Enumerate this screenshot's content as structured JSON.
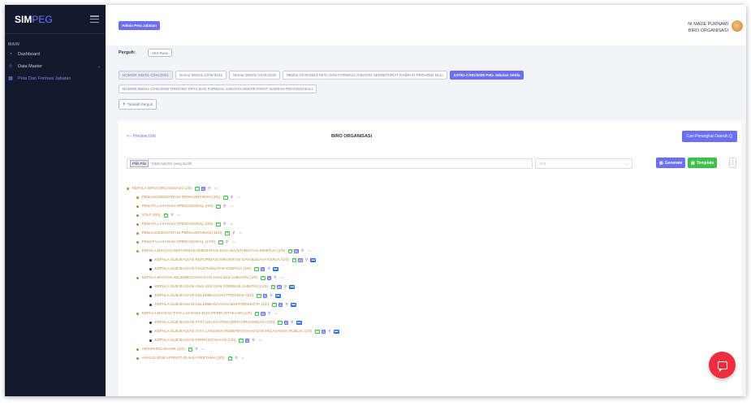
{
  "sidebar": {
    "brand_main": "SIM",
    "brand_accent": "PEG",
    "section_label": "MAIN",
    "items": [
      {
        "label": "Dashboard",
        "icon": "dashboard-icon"
      },
      {
        "label": "Data Master",
        "icon": "star-icon"
      },
      {
        "label": "Peta Dan Formasi Jabatan",
        "icon": "table-icon"
      }
    ]
  },
  "topbar": {
    "admin_button": "Admin Peta Jabatan",
    "user_name": "NI MADE PURNAMI",
    "user_unit": "BIRO ORGANISASI"
  },
  "perguh": {
    "label": "Perguh:",
    "setting_button": "Atur Ruan",
    "tabs_row1": [
      {
        "label": "NOMOR 362/01-C/HK/2021",
        "state": "shaded"
      },
      {
        "label": "Nomor 858/01-C/HK/2021",
        "state": "normal"
      },
      {
        "label": "Nomor 905/01-C/HK/2022",
        "state": "normal"
      },
      {
        "label": "883/01-C/HK/2024 PETA DAN FORMASI JABATAN SEKRETARIAT DAERAH PROVINSI BALI",
        "state": "normal"
      },
      {
        "label": "337/01-C/HK/2025 Peta Jabatan Setda",
        "state": "selected"
      }
    ],
    "tabs_row2": [
      {
        "label": "NOMOR 660/01-C/HK/2025 TENTANG PETA DAN FORMASI JABATAN SEKRETARIAT DAERAH PROVINSI BALI",
        "state": "normal"
      }
    ],
    "tambah_button": "Tambah Perguh"
  },
  "card": {
    "prev_link": "<-- Preview Unit",
    "title": "BIRO ORGANISASI",
    "cari_button": "Cari Perangkat Daerah Q",
    "file_button": "Pilih File",
    "file_text": "Tidak ada file yang dipilih",
    "select_placeholder": "Unit",
    "generate_button": "Generate",
    "template_button": "Template",
    "kebab": "⋮"
  },
  "tree": [
    {
      "label": "KEPALA BIRO ORGANISASI (1/0)",
      "level": 0,
      "grid": true,
      "msg": "outline"
    },
    {
      "label": "PENGADMINISTRASI PERKANTORAN (3/0)",
      "level": 1,
      "grid": false,
      "msg": "outline"
    },
    {
      "label": "PENATA LAYANAN OPERASIONAL (0/0)",
      "level": 1,
      "grid": false,
      "msg": "outline"
    },
    {
      "label": "STAF (0/0)",
      "level": 1,
      "grid": false,
      "msg": "outline"
    },
    {
      "label": "PENATA LAYANAN OPERASIONAL (0/0)",
      "level": 1,
      "grid": false,
      "msg": "outline"
    },
    {
      "label": "PENGADMINISTRASI PERKANTORAN (11/0)",
      "level": 1,
      "grid": false,
      "msg": "outline"
    },
    {
      "label": "PENATA LAYANAN OPERASIONAL (17/0)",
      "level": 1,
      "grid": false,
      "msg": "outline"
    },
    {
      "label": "KEPALA BAGIAN REFORMASI BIROKRASI DAN AKUNTABILITAS KINERJA (1/0)",
      "level": 1,
      "grid": true,
      "msg": "outline"
    },
    {
      "label": "KEPALA SUB BAGIAN REFORMASI BIROKRASI DAN BUDAYA KERJA (1/0)",
      "level": 2,
      "grid": true,
      "msg": "filled"
    },
    {
      "label": "KEPALA SUB BAGIAN AKUNTABILITAS KINERJA (1/0)",
      "level": 2,
      "grid": true,
      "msg": "filled"
    },
    {
      "label": "KEPALA BAGIAN KELEMBAGAAN DAN ANALISIS JABATAN (1/0)",
      "level": 1,
      "grid": true,
      "msg": "outline"
    },
    {
      "label": "KEPALA SUB BAGIAN ANALISIS DAN FORMASI JABATAN (1/0)",
      "level": 2,
      "grid": true,
      "msg": "filled"
    },
    {
      "label": "KEPALA SUB BAGIAN KELEMBAGAAN PROVINSI (1/0)",
      "level": 2,
      "grid": true,
      "msg": "filled"
    },
    {
      "label": "KEPALA SUB BAGIAN KELEMBAGAAN KABUPATEN/KOTA (1/0)",
      "level": 2,
      "grid": true,
      "msg": "filled"
    },
    {
      "label": "KEPALA BAGIAN TATA LAKSANA DAN PERPUSTAKAAN (1/0)",
      "level": 1,
      "grid": true,
      "msg": "outline"
    },
    {
      "label": "KEPALA SUB BAGIAN TATA USAHA PADA BIRO ORGANISASI (1/0)",
      "level": 2,
      "grid": true,
      "msg": "filled"
    },
    {
      "label": "KEPALA SUB BAGIAN TATA LAKSANA PEMERINTAHAN DAN PELAYANAN PUBLIK (1/0)",
      "level": 2,
      "grid": true,
      "msg": "filled"
    },
    {
      "label": "KEPALA SUB BAGIAN PERPUSTAKAAN (1/0)",
      "level": 2,
      "grid": true,
      "msg": "outline"
    },
    {
      "label": "ARSIPARIS MAHIR (1/0)",
      "level": 1,
      "grid": false,
      "msg": "outline"
    },
    {
      "label": "ANALIS SDM APARATUR AHLI PERTAMA (3/0)",
      "level": 1,
      "grid": false,
      "msg": "outline"
    }
  ],
  "colors": {
    "accent": "#6b6ff5",
    "sidebar_bg": "#141a2e",
    "tree_text": "#c98b3a",
    "template_green": "#3fbf4c",
    "fab_red": "#ee2e3f"
  }
}
